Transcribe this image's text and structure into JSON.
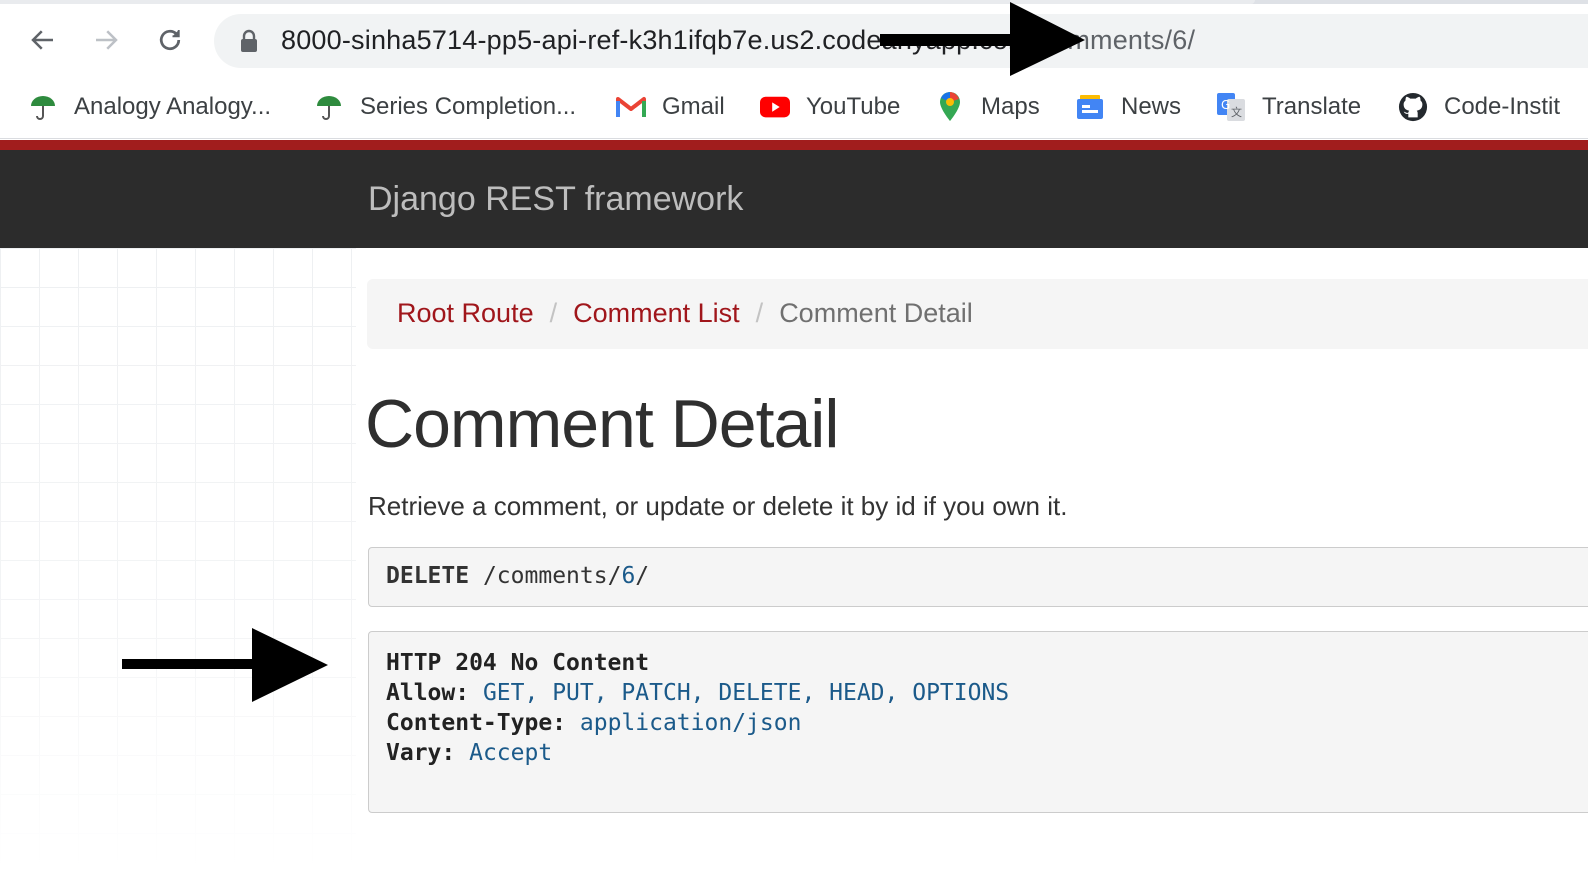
{
  "browser": {
    "url": {
      "host": "8000-sinha5714-pp5-api-ref-k3h1ifqb7e.us2.codeanyapp.com",
      "path": "/comments/6/"
    },
    "bookmarks": [
      {
        "label": "Analogy Analogy...",
        "icon": "umbrella-icon"
      },
      {
        "label": "Series Completion...",
        "icon": "umbrella-icon"
      },
      {
        "label": "Gmail",
        "icon": "gmail-icon"
      },
      {
        "label": "YouTube",
        "icon": "youtube-icon"
      },
      {
        "label": "Maps",
        "icon": "maps-pin-icon"
      },
      {
        "label": "News",
        "icon": "news-icon"
      },
      {
        "label": "Translate",
        "icon": "translate-icon"
      },
      {
        "label": "Code-Instit",
        "icon": "github-icon"
      }
    ]
  },
  "navbar": {
    "brand": "Django REST framework"
  },
  "breadcrumb": {
    "items": [
      "Root Route",
      "Comment List"
    ],
    "active": "Comment Detail",
    "separator": "/"
  },
  "page": {
    "title": "Comment Detail",
    "description": "Retrieve a comment, or update or delete it by id if you own it."
  },
  "request": {
    "method": "DELETE",
    "path_prefix": "/comments/",
    "id": "6",
    "path_suffix": "/"
  },
  "response": {
    "status": "HTTP 204 No Content",
    "headers": [
      {
        "name": "Allow:",
        "value": "GET, PUT, PATCH, DELETE, HEAD, OPTIONS"
      },
      {
        "name": "Content-Type:",
        "value": "application/json"
      },
      {
        "name": "Vary:",
        "value": "Accept"
      }
    ]
  },
  "colors": {
    "accent_red": "#a11d1d",
    "link_red": "#a0161b",
    "navbar": "#2c2c2c",
    "value_blue": "#1b5a8a"
  }
}
